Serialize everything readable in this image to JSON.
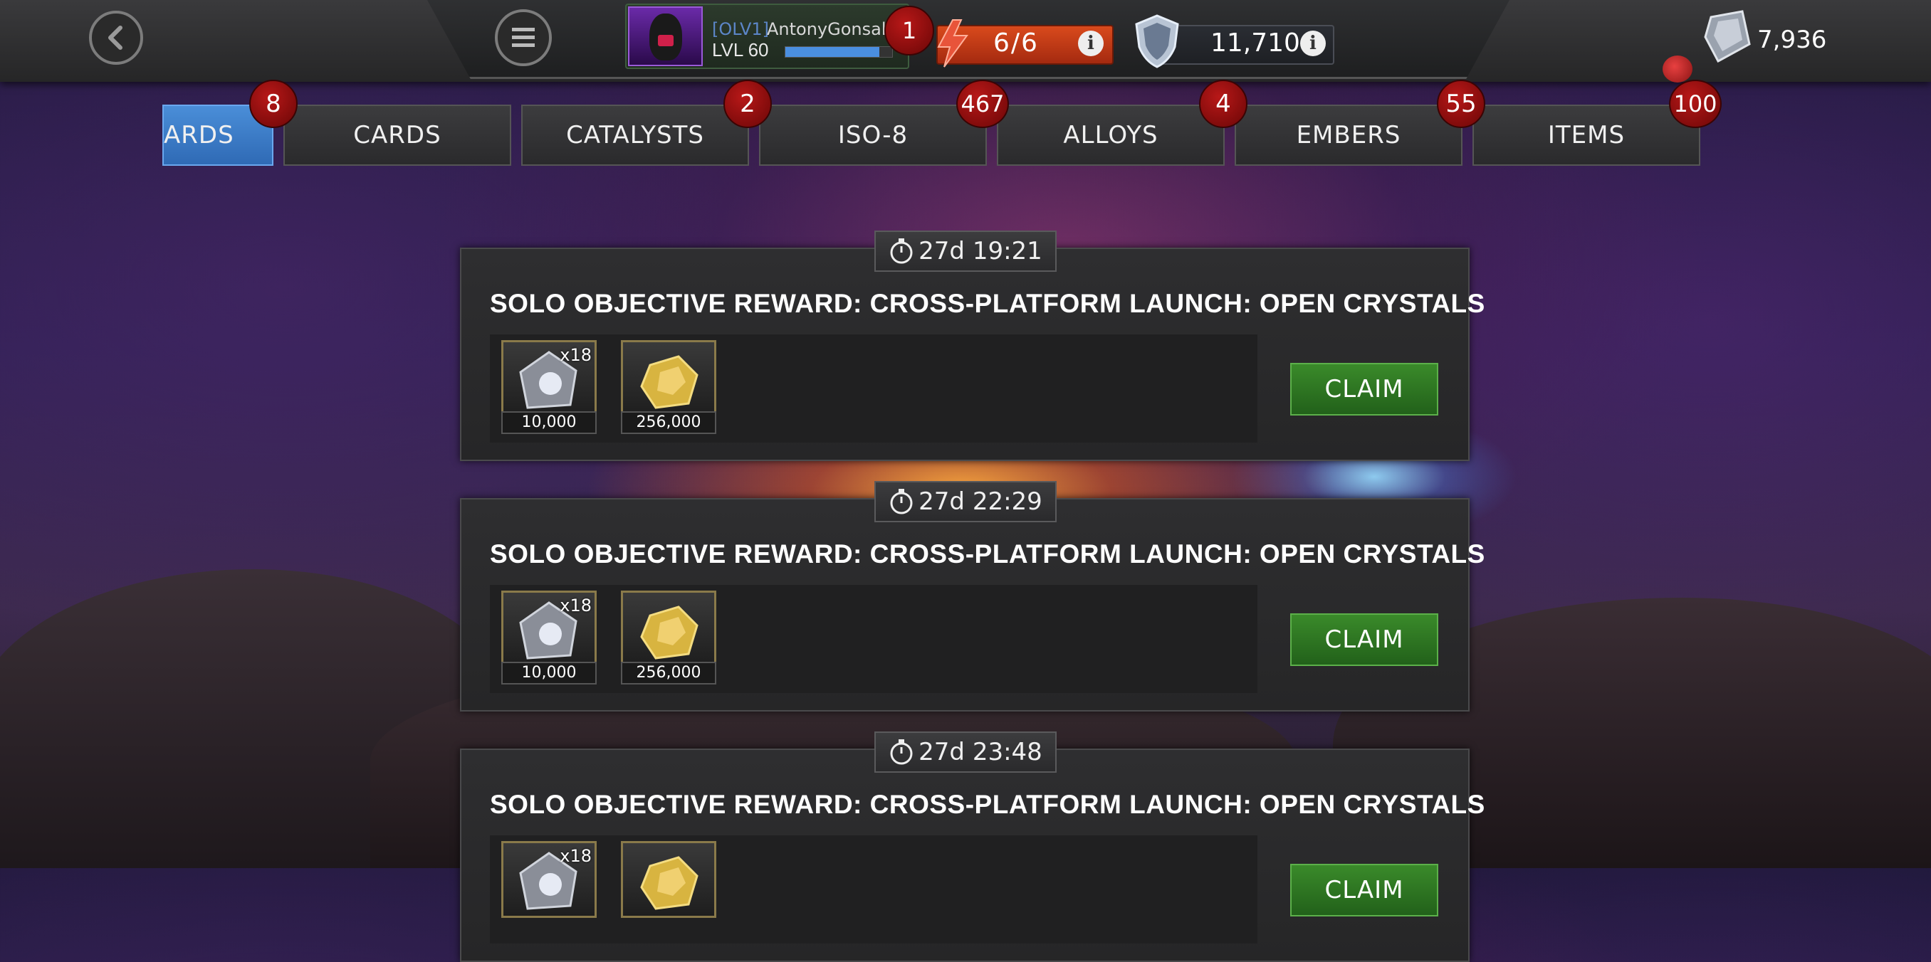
{
  "header": {
    "profile": {
      "alliance_tag": "[OLV1]",
      "name": "AntonyGonsalve",
      "level": "LVL 60",
      "xp_progress": 0.88
    },
    "notification_count": "1",
    "energy": {
      "value": "6/6"
    },
    "shield": {
      "value": "11,710"
    },
    "units": {
      "value": "7,936"
    }
  },
  "tabs": [
    {
      "label": "ARDS",
      "badge": "8"
    },
    {
      "label": "CARDS",
      "badge": "2"
    },
    {
      "label": "CATALYSTS",
      "badge": "467"
    },
    {
      "label": "ISO-8",
      "badge": "4"
    },
    {
      "label": "ALLOYS",
      "badge": "55"
    },
    {
      "label": "EMBERS",
      "badge": "100"
    },
    {
      "label": "ITEMS",
      "badge": ""
    }
  ],
  "rewards": [
    {
      "timer": "27d 19:21",
      "title": "SOLO OBJECTIVE REWARD: CROSS-PLATFORM LAUNCH: OPEN CRYSTALS",
      "items": [
        {
          "icon": "crystal-icon",
          "qty": "x18",
          "value": "10,000"
        },
        {
          "icon": "gold-icon",
          "qty": "",
          "value": "256,000"
        }
      ],
      "claim_label": "CLAIM"
    },
    {
      "timer": "27d 22:29",
      "title": "SOLO OBJECTIVE REWARD: CROSS-PLATFORM LAUNCH: OPEN CRYSTALS",
      "items": [
        {
          "icon": "crystal-icon",
          "qty": "x18",
          "value": "10,000"
        },
        {
          "icon": "gold-icon",
          "qty": "",
          "value": "256,000"
        }
      ],
      "claim_label": "CLAIM"
    },
    {
      "timer": "27d 23:48",
      "title": "SOLO OBJECTIVE REWARD: CROSS-PLATFORM LAUNCH: OPEN CRYSTALS",
      "items": [
        {
          "icon": "crystal-icon",
          "qty": "x18",
          "value": ""
        },
        {
          "icon": "gold-icon",
          "qty": "",
          "value": ""
        }
      ],
      "claim_label": "CLAIM"
    }
  ]
}
